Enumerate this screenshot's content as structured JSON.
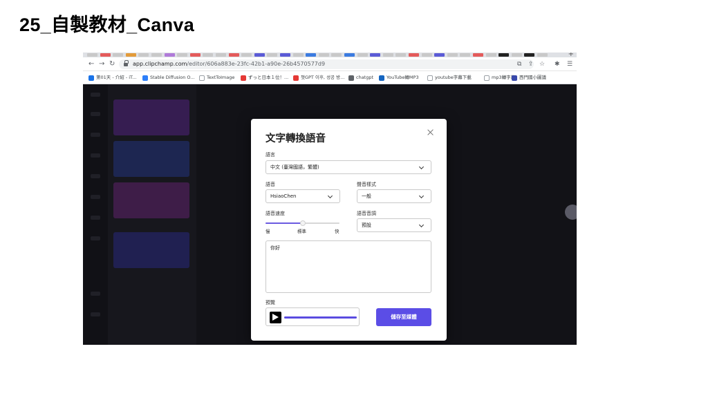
{
  "slide": {
    "title": "25_自製教材_Canva"
  },
  "browser": {
    "tab_colors": [
      "#c9c9c9",
      "#e45b5b",
      "#c9c9c9",
      "#e39b3a",
      "#c9c9c9",
      "#c9c9c9",
      "#b07ad9",
      "#c9c9c9",
      "#e45b5b",
      "#c9c9c9",
      "#c9c9c9",
      "#e45b5b",
      "#c9c9c9",
      "#5b5bd6",
      "#c9c9c9",
      "#5b5bd6",
      "#c9c9c9",
      "#3b7be0",
      "#c9c9c9",
      "#c9c9c9",
      "#3b7be0",
      "#c9c9c9",
      "#5b5bd6",
      "#c9c9c9",
      "#c9c9c9",
      "#e45b5b",
      "#c9c9c9",
      "#5b5bd6",
      "#c9c9c9",
      "#c9c9c9",
      "#e45b5b",
      "#c9c9c9",
      "#222222",
      "#c9c9c9",
      "#222222",
      "#c9c9c9"
    ],
    "url_host": "app.clipchamp.com",
    "url_path": "/editor/606a883e-23fc-42b1-a90e-26b4570577d9",
    "bookmarks": [
      {
        "label": "第01天 - 介紹 - iT...",
        "fav_color": "#1a73e8",
        "glyph": ""
      },
      {
        "label": "Stable Diffusion O...",
        "fav_color": "#2d7ff9",
        "glyph": ""
      },
      {
        "label": "TextToImage",
        "fav_color": "#ffffff",
        "glyph": ""
      },
      {
        "label": "ずっと日本１位！...",
        "fav_color": "#e53935",
        "glyph": ""
      },
      {
        "label": "챗GPT 이후, 성공 방...",
        "fav_color": "#e53935",
        "glyph": ""
      },
      {
        "label": "chatgpt",
        "fav_color": "#5f6368",
        "glyph": ""
      },
      {
        "label": "YouTube轉MP3",
        "fav_color": "#1565c0",
        "glyph": ""
      },
      {
        "label": "youtube字幕下載",
        "fav_color": "#ffffff",
        "glyph": ""
      },
      {
        "label": "mp3轉字幕",
        "fav_color": "#ffffff",
        "glyph": ""
      },
      {
        "label": "西門國小圖議",
        "fav_color": "#3949ab",
        "glyph": ""
      }
    ]
  },
  "dialog": {
    "title": "文字轉換語音",
    "language_label": "語言",
    "language_value": "中文 (臺灣國語，繁體)",
    "voice_label": "語音",
    "voice_value": "HsiaoChen",
    "style_label": "聲音樣式",
    "style_value": "一般",
    "speed_label": "語音速度",
    "speed_slow": "慢",
    "speed_normal": "標準",
    "speed_fast": "快",
    "speed_level": 0.5,
    "pitch_label": "語音音調",
    "pitch_value": "預設",
    "text_value": "你好",
    "preview_label": "預覽",
    "preview_progress": 1.0,
    "save_label": "儲存至媒體"
  },
  "colors": {
    "accent": "#5b4de6",
    "app_bg": "#1e1e28"
  }
}
